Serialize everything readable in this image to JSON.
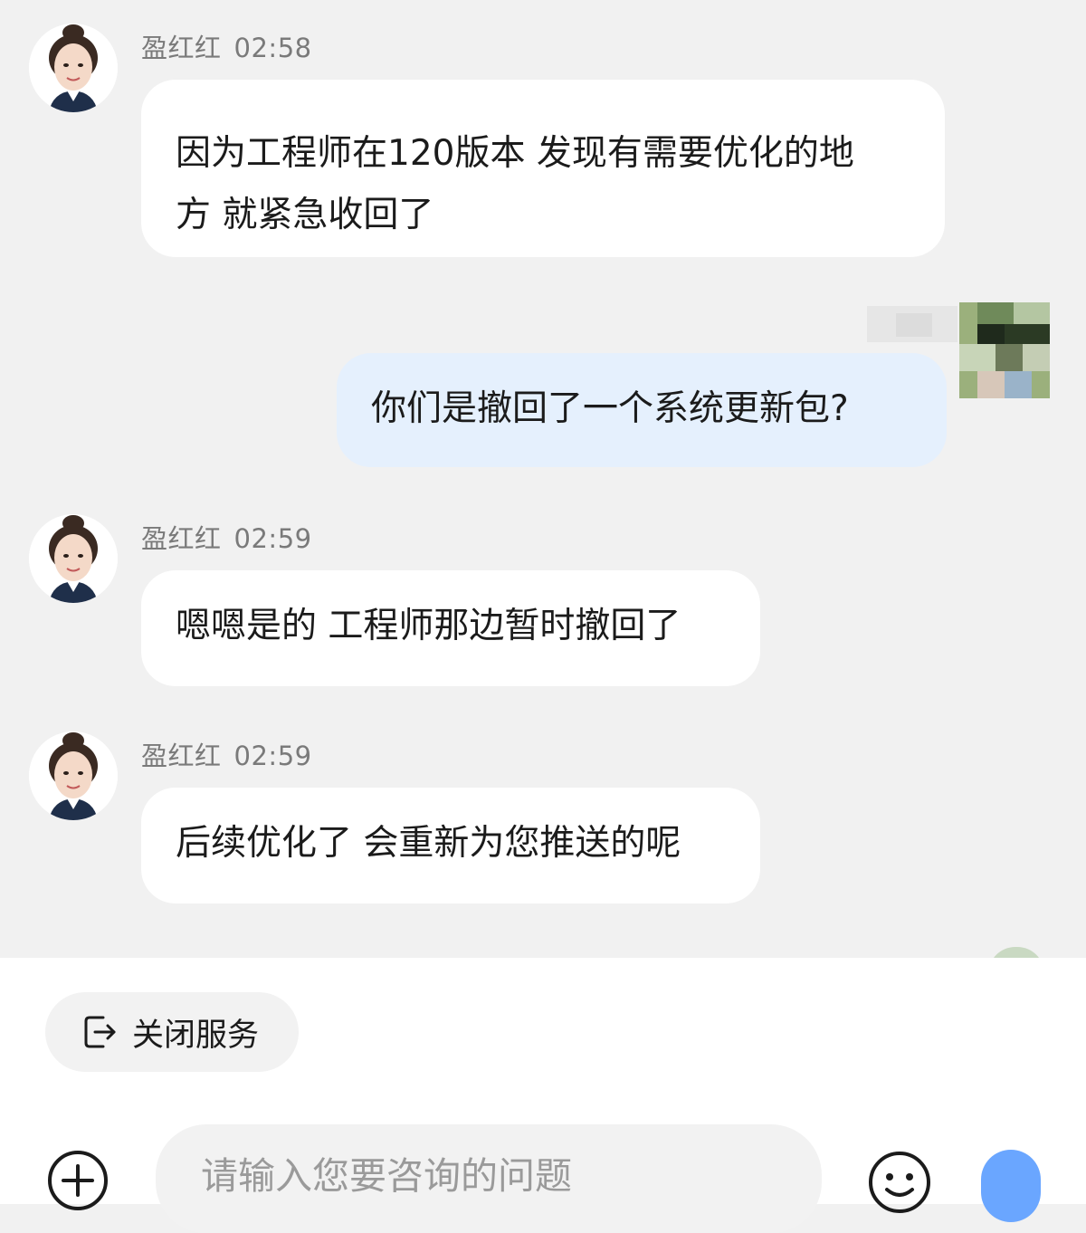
{
  "messages": [
    {
      "sender": "盈红红",
      "time": "02:58",
      "lines": [
        "因为工程师在120版本 发现有需要优化的地",
        "方 就紧急收回了"
      ]
    },
    {
      "self": true,
      "text": "你们是撤回了一个系统更新包?"
    },
    {
      "sender": "盈红红",
      "time": "02:59",
      "text": "嗯嗯是的 工程师那边暂时撤回了"
    },
    {
      "sender": "盈红红",
      "time": "02:59",
      "text": "后续优化了 会重新为您推送的呢"
    }
  ],
  "actions": {
    "close_service_label": "关闭服务"
  },
  "composer": {
    "placeholder": "请输入您要咨询的问题"
  },
  "colors": {
    "self_bubble": "#e5f0fd",
    "agent_bubble": "#ffffff",
    "background": "#f1f1f1",
    "send_button": "#6aa6ff"
  },
  "icons": {
    "close_service": "exit-icon",
    "attach": "plus-circle-icon",
    "emoji": "smile-icon",
    "send": "send-icon"
  }
}
